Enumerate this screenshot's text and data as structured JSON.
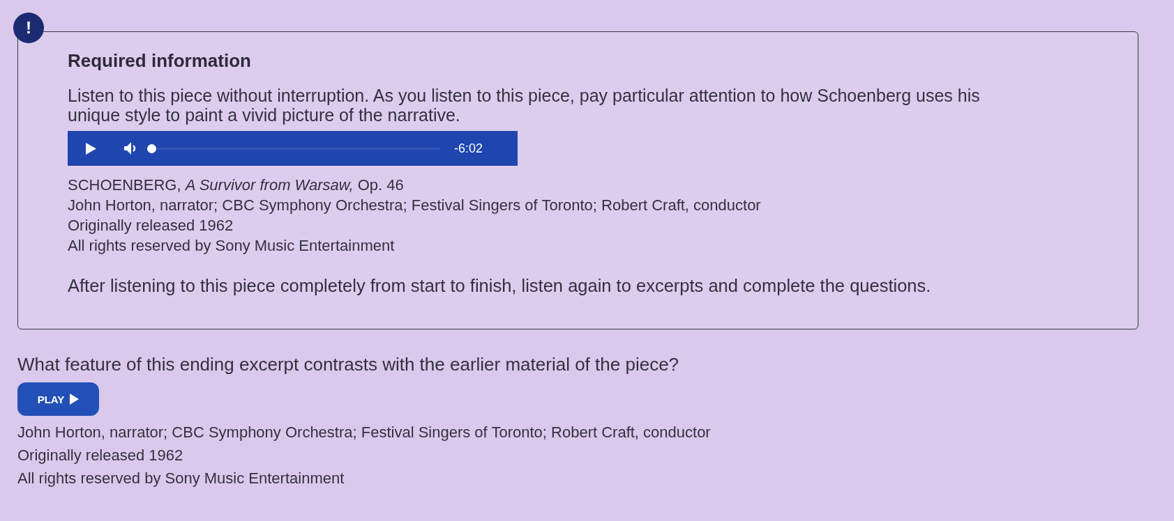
{
  "alert": {
    "badge": "!"
  },
  "required_info": {
    "title": "Required information",
    "intro": "Listen to this piece without interruption. As you listen to this piece, pay particular attention to how Schoenberg uses his unique style to paint a vivid picture of the narrative.",
    "player": {
      "level": 0,
      "time": "-6:02"
    },
    "credits": [
      "SCHOENBERG, *A Survivor from Warsaw,* Op. 46",
      "John Horton, narrator; CBC Symphony Orchestra; Festival Singers of Toronto; Robert Craft, conductor",
      "Originally released 1962",
      "All rights reserved by Sony Music Entertainment"
    ],
    "instructions": "After listening to this piece completely from start to finish, listen again to excerpts and complete the questions."
  },
  "question": {
    "text": "What feature of this ending excerpt contrasts with the earlier material of the piece?",
    "play_button": "PLAY",
    "credits": [
      "John Horton, narrator; CBC Symphony Orchestra; Festival Singers of Toronto; Robert Craft, conductor",
      "Originally released 1962",
      "All rights reserved by Sony Music Entertainment"
    ]
  }
}
